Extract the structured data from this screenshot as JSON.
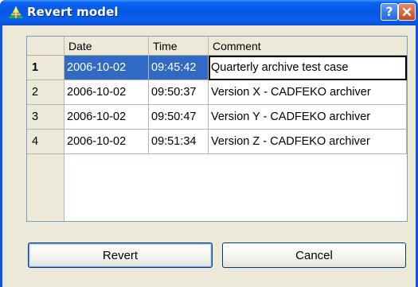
{
  "window": {
    "title": "Revert model",
    "help_label": "?",
    "colors": {
      "title_bar": "#0558e6",
      "selection": "#316ac5",
      "face": "#ece9d8"
    }
  },
  "table": {
    "columns": [
      "Date",
      "Time",
      "Comment"
    ],
    "rows": [
      {
        "index": "1",
        "date": "2006-10-02",
        "time": "09:45:42",
        "comment": "Quarterly archive test case"
      },
      {
        "index": "2",
        "date": "2006-10-02",
        "time": "09:50:37",
        "comment": "Version X - CADFEKO archiver"
      },
      {
        "index": "3",
        "date": "2006-10-02",
        "time": "09:50:47",
        "comment": "Version Y - CADFEKO archiver"
      },
      {
        "index": "4",
        "date": "2006-10-02",
        "time": "09:51:34",
        "comment": "Version Z - CADFEKO archiver"
      }
    ]
  },
  "buttons": {
    "revert": "Revert",
    "cancel": "Cancel"
  },
  "icons": {
    "app": "feko-antenna-icon",
    "help": "help-icon",
    "close": "close-icon"
  }
}
